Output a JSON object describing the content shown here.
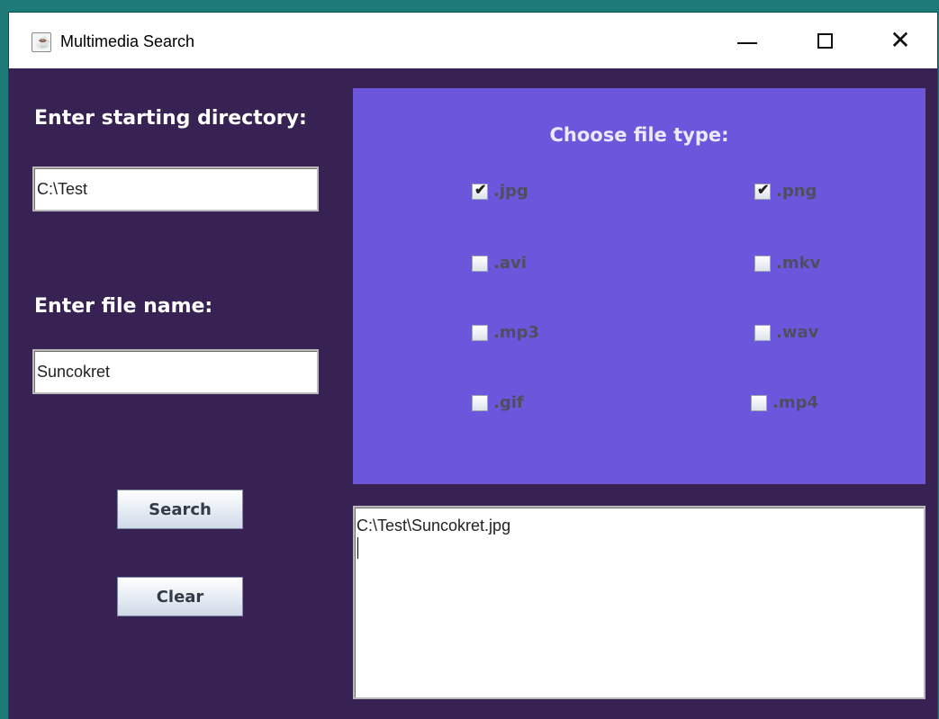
{
  "window": {
    "title": "Multimedia Search",
    "icon": "java-cup-icon",
    "controls": [
      "minimize",
      "maximize",
      "close"
    ],
    "controls_glyphs": {
      "minimize": "",
      "maximize": "",
      "close": "✕"
    }
  },
  "left_panel": {
    "directory_label": "Enter starting directory:",
    "directory_value": "C:\\Test",
    "file_name_label": "Enter file name:",
    "file_name_value": "Suncokret",
    "search_button": "Search",
    "clear_button": "Clear"
  },
  "file_types": {
    "title": "Choose file type:",
    "options": [
      {
        "label": ".jpg",
        "checked": true
      },
      {
        "label": ".png",
        "checked": true
      },
      {
        "label": ".avi",
        "checked": false
      },
      {
        "label": ".mkv",
        "checked": false
      },
      {
        "label": ".mp3",
        "checked": false
      },
      {
        "label": ".wav",
        "checked": false
      },
      {
        "label": ".gif",
        "checked": false
      },
      {
        "label": ".mp4",
        "checked": false
      }
    ]
  },
  "output": {
    "text": "C:\\Test\\Suncokret.jpg"
  },
  "colors": {
    "window_background": "#372253",
    "panel_background": "#6c57dc",
    "label_text": "#ffffff"
  }
}
